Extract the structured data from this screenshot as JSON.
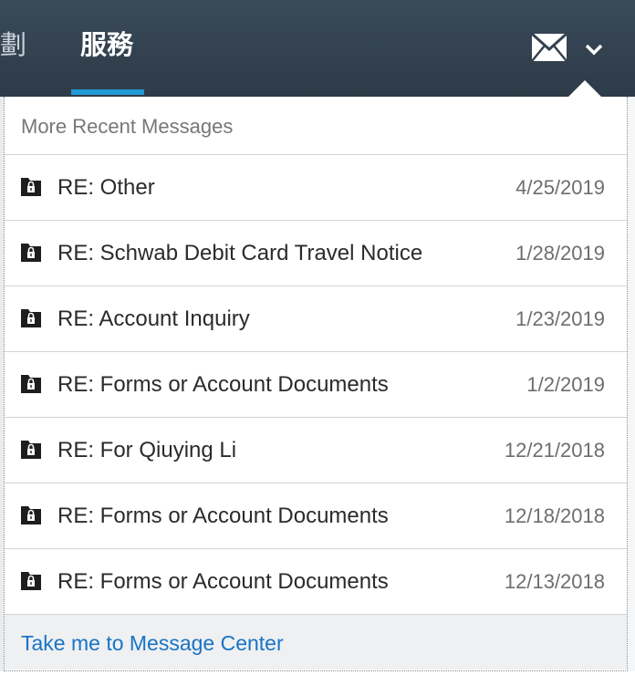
{
  "nav": {
    "partial_tab": "劃",
    "active_tab": "服務"
  },
  "header": {
    "icons": {
      "mail": "mail-icon",
      "dropdown": "chevron-down-icon"
    }
  },
  "colors": {
    "topbar": "#34424f",
    "active_underline": "#1f9ad6",
    "link": "#1a73c5"
  },
  "panel": {
    "title": "More Recent Messages",
    "messages": [
      {
        "subject": "RE: Other",
        "date": "4/25/2019",
        "icon": "lock-folder-icon"
      },
      {
        "subject": "RE: Schwab Debit Card Travel Notice",
        "date": "1/28/2019",
        "icon": "lock-folder-icon"
      },
      {
        "subject": "RE: Account Inquiry",
        "date": "1/23/2019",
        "icon": "lock-folder-icon"
      },
      {
        "subject": "RE: Forms or Account Documents",
        "date": "1/2/2019",
        "icon": "lock-folder-icon"
      },
      {
        "subject": "RE: For Qiuying Li",
        "date": "12/21/2018",
        "icon": "lock-folder-icon"
      },
      {
        "subject": "RE: Forms or Account Documents",
        "date": "12/18/2018",
        "icon": "lock-folder-icon"
      },
      {
        "subject": "RE: Forms or Account Documents",
        "date": "12/13/2018",
        "icon": "lock-folder-icon"
      }
    ],
    "footer_link": "Take me to Message Center"
  }
}
